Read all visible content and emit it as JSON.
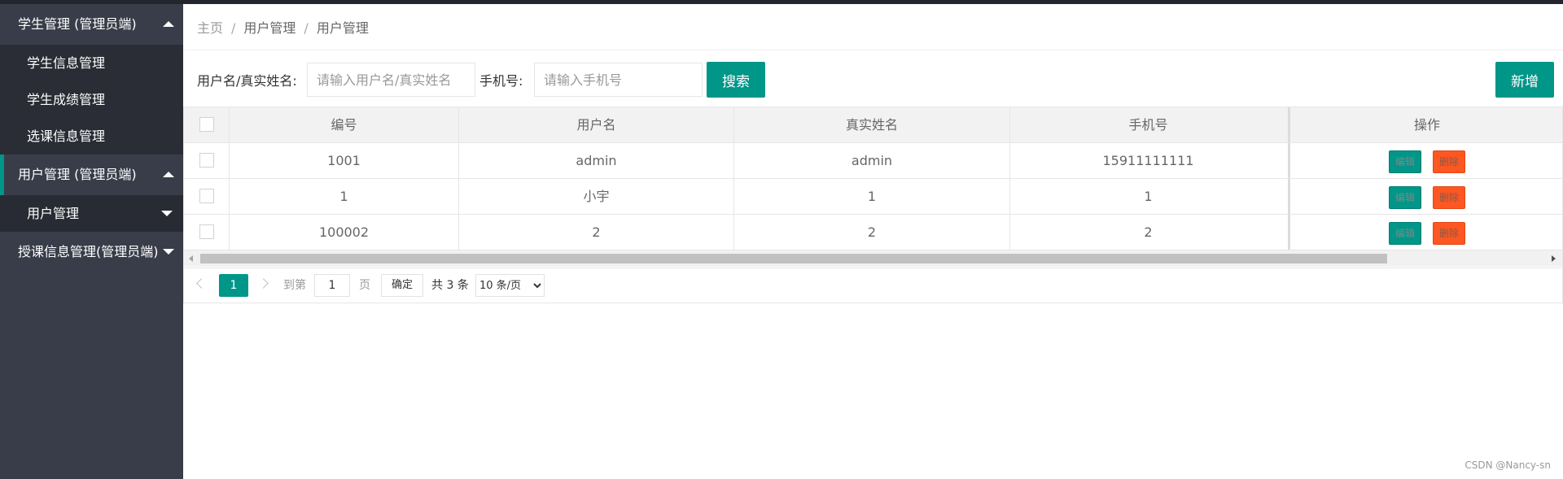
{
  "sidebar": {
    "group1": {
      "label": "学生管理 (管理员端)",
      "items": [
        "学生信息管理",
        "学生成绩管理",
        "选课信息管理"
      ]
    },
    "group2": {
      "label": "用户管理 (管理员端)",
      "active_item": "用户管理"
    },
    "group3": {
      "label": "授课信息管理(管理员端)"
    }
  },
  "breadcrumb": [
    "主页",
    "用户管理",
    "用户管理"
  ],
  "breadcrumb_sep": "/",
  "search": {
    "username_label": "用户名/真实姓名:",
    "username_placeholder": "请输入用户名/真实姓名",
    "phone_label": "手机号:",
    "phone_placeholder": "请输入手机号",
    "search_button": "搜索",
    "add_button": "新增"
  },
  "table": {
    "columns": [
      "编号",
      "用户名",
      "真实姓名",
      "手机号",
      "操作"
    ],
    "rows": [
      [
        "1001",
        "admin",
        "admin",
        "15911111111"
      ],
      [
        "1",
        "小宇",
        "1",
        "1"
      ],
      [
        "100002",
        "2",
        "2",
        "2"
      ]
    ],
    "edit_label": "编辑",
    "delete_label": "删除"
  },
  "pagination": {
    "current_page": "1",
    "goto_label": "到第",
    "goto_value": "1",
    "page_unit": "页",
    "confirm": "确定",
    "total": "共 3 条",
    "page_size": "10 条/页"
  },
  "watermark": "CSDN @Nancy-sn",
  "colors": {
    "primary": "#009688",
    "danger": "#ff5722",
    "sidebar_bg": "#393d49"
  }
}
